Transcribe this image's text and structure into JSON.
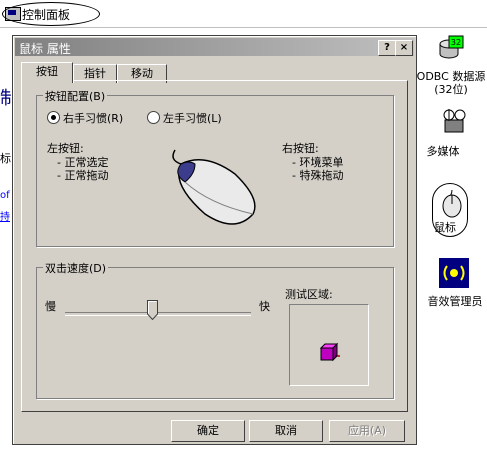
{
  "window": {
    "title": "控制面板"
  },
  "background": {
    "left_big_char": "制",
    "left_small": "标",
    "left_link1": "of",
    "left_link2": "持"
  },
  "right_panel": {
    "items": [
      {
        "label_line1": "ODBC 数据源",
        "label_line2": "(32位)",
        "icon": "odbc-icon"
      },
      {
        "label_line1": "多媒体",
        "label_line2": "",
        "icon": "multimedia-icon"
      },
      {
        "label_line1": "鼠标",
        "label_line2": "",
        "icon": "mouse-icon"
      },
      {
        "label_line1": "音效管理员",
        "label_line2": "",
        "icon": "sound-manager-icon"
      }
    ]
  },
  "dialog": {
    "title": "鼠标 属性",
    "help_btn": "?",
    "close_btn": "×",
    "tabs": [
      "按钮",
      "指针",
      "移动"
    ],
    "button_config": {
      "legend": "按钮配置(B)",
      "right_handed": "右手习惯(R)",
      "left_handed": "左手习惯(L)",
      "left_button_title": "左按钮:",
      "left_button_items": [
        "- 正常选定",
        "- 正常拖动"
      ],
      "right_button_title": "右按钮:",
      "right_button_items": [
        "- 环境菜单",
        "- 特殊拖动"
      ]
    },
    "double_click": {
      "legend": "双击速度(D)",
      "slow": "慢",
      "fast": "快",
      "test_area": "测试区域:"
    },
    "buttons": {
      "ok": "确定",
      "cancel": "取消",
      "apply": "应用(A)"
    }
  }
}
